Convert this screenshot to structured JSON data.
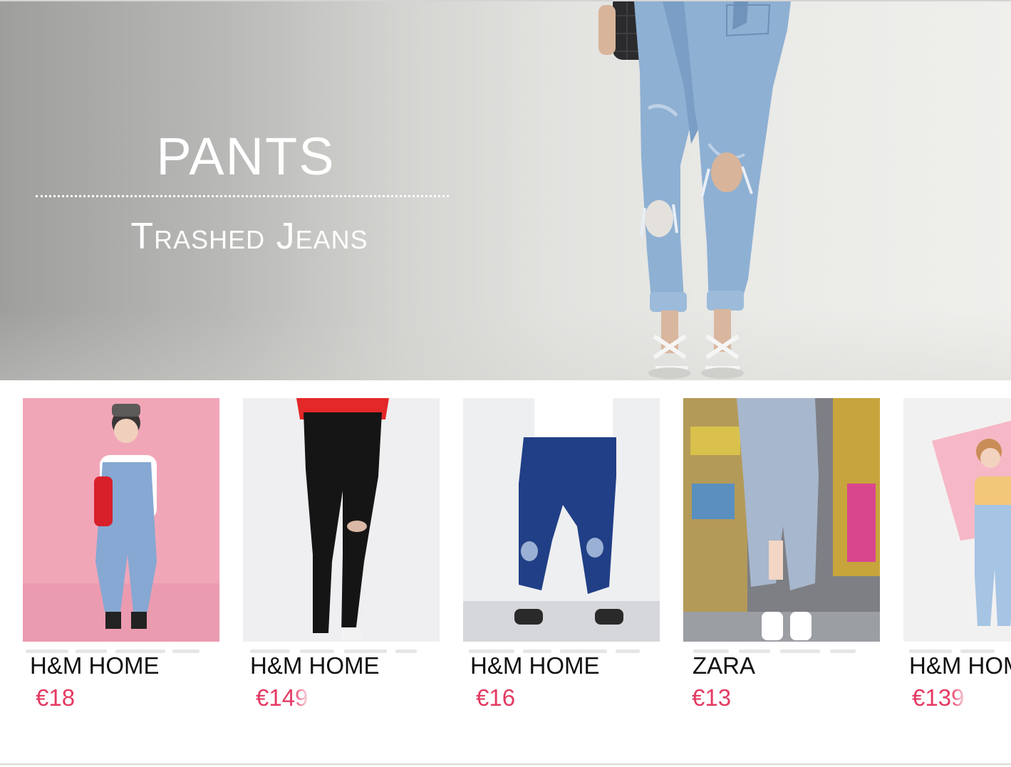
{
  "banner": {
    "title": "PANTS",
    "subtitle": "Trashed Jeans"
  },
  "products": [
    {
      "brand": "H&M HOME",
      "price": "€18",
      "photo": "denim-overalls-pink-backdrop"
    },
    {
      "brand": "H&M HOME",
      "price": "€149",
      "photo": "black-ripped-skinny-jeans"
    },
    {
      "brand": "H&M HOME",
      "price": "€16",
      "photo": "dark-blue-ripped-drawstring-jeans"
    },
    {
      "brand": "ZARA",
      "price": "€13",
      "photo": "acid-wash-ripped-jeans-graffiti"
    },
    {
      "brand": "H&M HOME",
      "price": "€139",
      "photo": "light-ripped-jeans-pink-backdrop"
    }
  ],
  "colors": {
    "price": "#e43a63",
    "brand": "#111111",
    "banner_text": "#ffffff"
  }
}
